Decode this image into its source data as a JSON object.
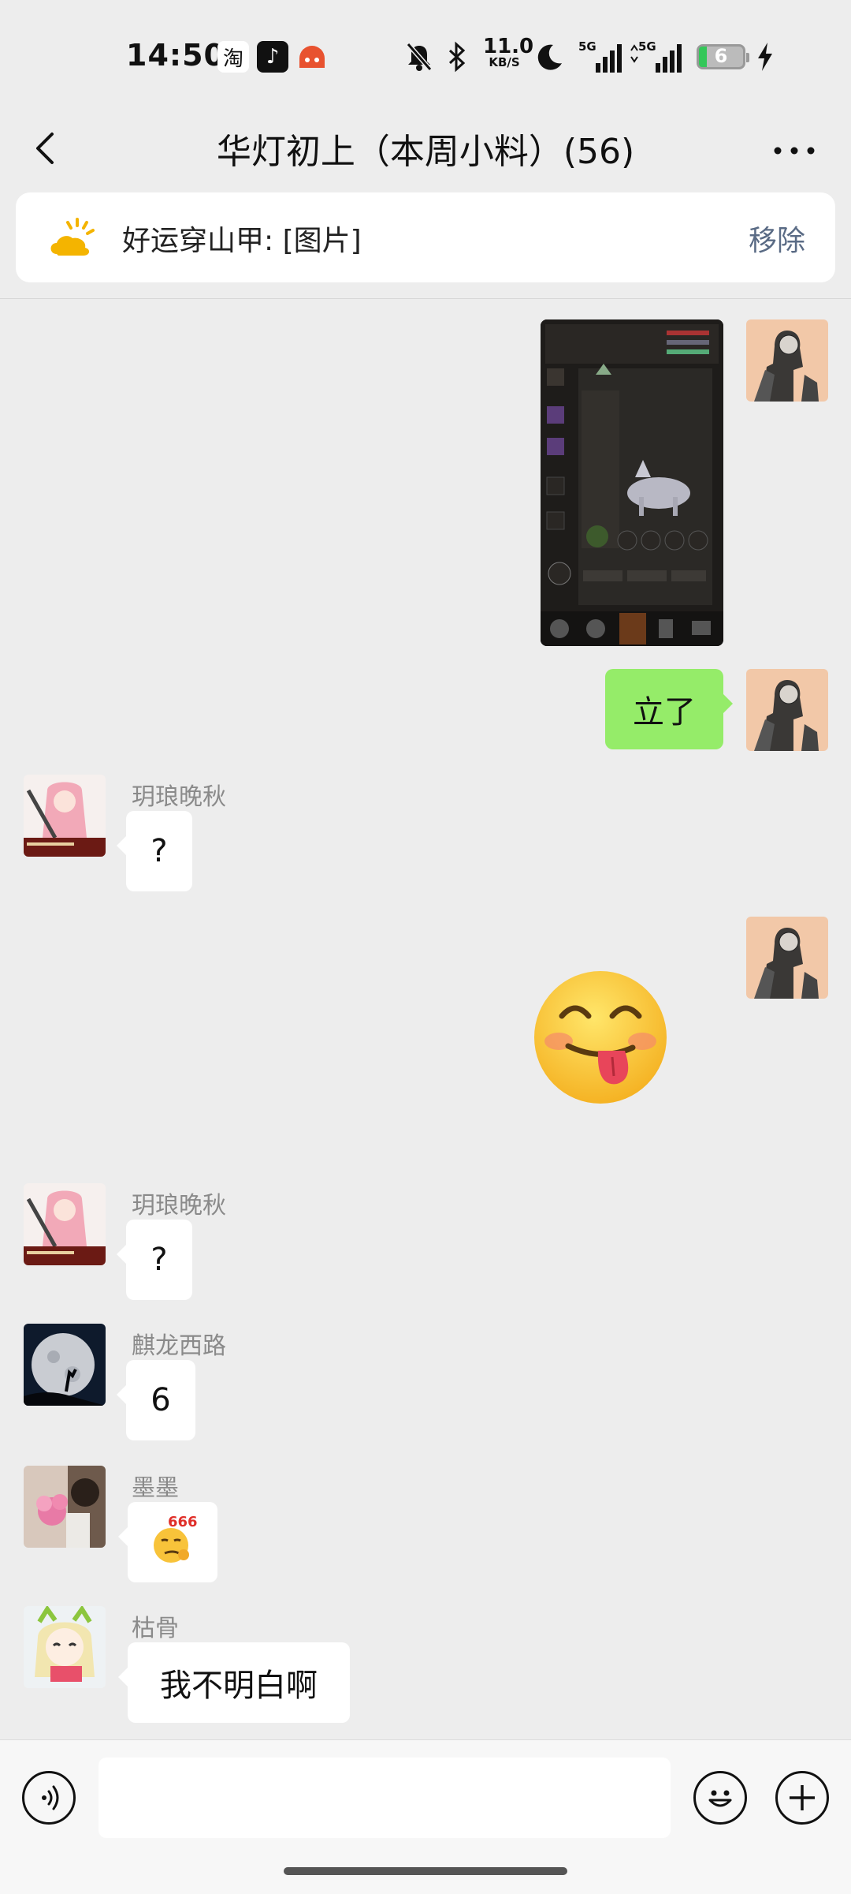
{
  "status_bar": {
    "time": "14:50",
    "apps": [
      {
        "name": "taobao-icon",
        "glyph": "淘"
      },
      {
        "name": "tiktok-icon",
        "glyph": "♪"
      },
      {
        "name": "app-icon"
      }
    ],
    "net_speed_value": "11.0",
    "net_speed_unit": "KB/S",
    "signal_1": "5G",
    "signal_2": "5G",
    "battery_level": "6"
  },
  "header": {
    "title": "华灯初上（本周小料）(56)",
    "back_icon": "chevron-left-icon",
    "more_icon": "more-horizontal-icon"
  },
  "pinned": {
    "text": "好运穿山甲: [图片]",
    "remove_label": "移除"
  },
  "messages": [
    {
      "type": "image",
      "side": "right",
      "content": "game-screenshot"
    },
    {
      "type": "text",
      "side": "right",
      "text": "立了"
    },
    {
      "type": "text",
      "side": "left",
      "sender": "玥琅晚秋",
      "text": "?"
    },
    {
      "type": "sticker",
      "side": "right",
      "content": "yum-emoji"
    },
    {
      "type": "text",
      "side": "left",
      "sender": "玥琅晚秋",
      "text": "?"
    },
    {
      "type": "text",
      "side": "left",
      "sender": "麒龙西路",
      "text": "6"
    },
    {
      "type": "emoji",
      "side": "left",
      "sender": "墨墨",
      "text": "666"
    },
    {
      "type": "text",
      "side": "left",
      "sender": "枯骨",
      "text": "我不明白啊"
    }
  ],
  "input_bar": {
    "voice_icon": "voice-icon",
    "emoji_icon": "emoji-icon",
    "plus_icon": "plus-icon",
    "text_value": ""
  },
  "colors": {
    "background": "#ededed",
    "own_bubble": "#95ec69",
    "remove_link": "#5a6b85"
  }
}
